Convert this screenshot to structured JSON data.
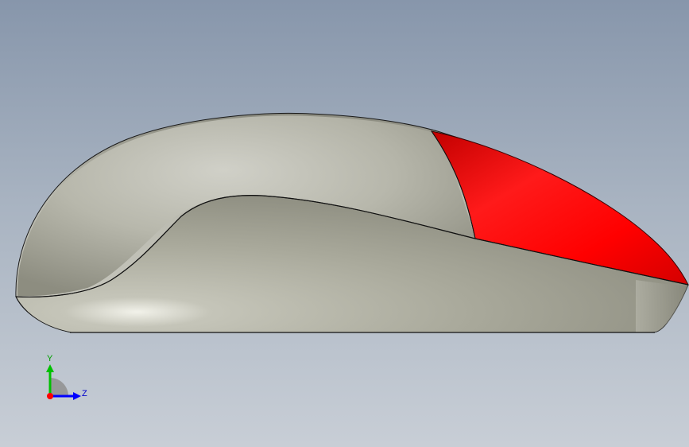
{
  "viewport": {
    "background_top": "#8796ab",
    "background_bottom": "#c8ced6"
  },
  "model": {
    "body_color": "#bdbdb1",
    "button_color": "#ff0000"
  },
  "triad": {
    "x_label": "",
    "y_label": "Y",
    "z_label": "Z",
    "y_color": "#00c000",
    "z_color": "#0000ff",
    "x_color": "#ff0000"
  }
}
